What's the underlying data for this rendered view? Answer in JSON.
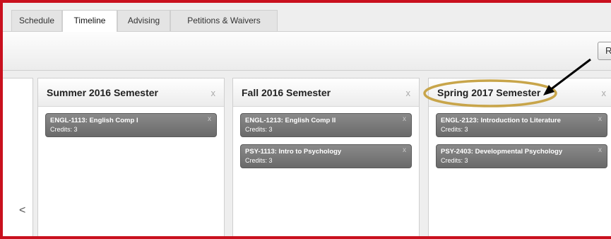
{
  "tabs": [
    {
      "label": "Schedule",
      "active": false
    },
    {
      "label": "Timeline",
      "active": true
    },
    {
      "label": "Advising",
      "active": false
    },
    {
      "label": "Petitions & Waivers",
      "active": false
    }
  ],
  "toolbar": {
    "button_label": "R"
  },
  "nav": {
    "prev_label": "<"
  },
  "semesters": [
    {
      "title": "Summer 2016 Semester",
      "close": "x",
      "courses": [
        {
          "name": "ENGL-1113: English Comp I",
          "credits": "Credits: 3",
          "close": "x"
        }
      ]
    },
    {
      "title": "Fall 2016 Semester",
      "close": "x",
      "courses": [
        {
          "name": "ENGL-1213: English Comp II",
          "credits": "Credits: 3",
          "close": "x"
        },
        {
          "name": "PSY-1113: Intro to Psychology",
          "credits": "Credits: 3",
          "close": "x"
        }
      ]
    },
    {
      "title": "Spring 2017 Semester",
      "close": "x",
      "courses": [
        {
          "name": "ENGL-2123: Introduction to Literature",
          "credits": "Credits: 3",
          "close": "x"
        },
        {
          "name": "PSY-2403: Developmental Psychology",
          "credits": "Credits: 3",
          "close": "x"
        }
      ]
    }
  ],
  "colors": {
    "frame": "#c9101e",
    "annotation_circle": "#c8a54a",
    "annotation_arrow": "#000000",
    "course_card": "#777777"
  }
}
